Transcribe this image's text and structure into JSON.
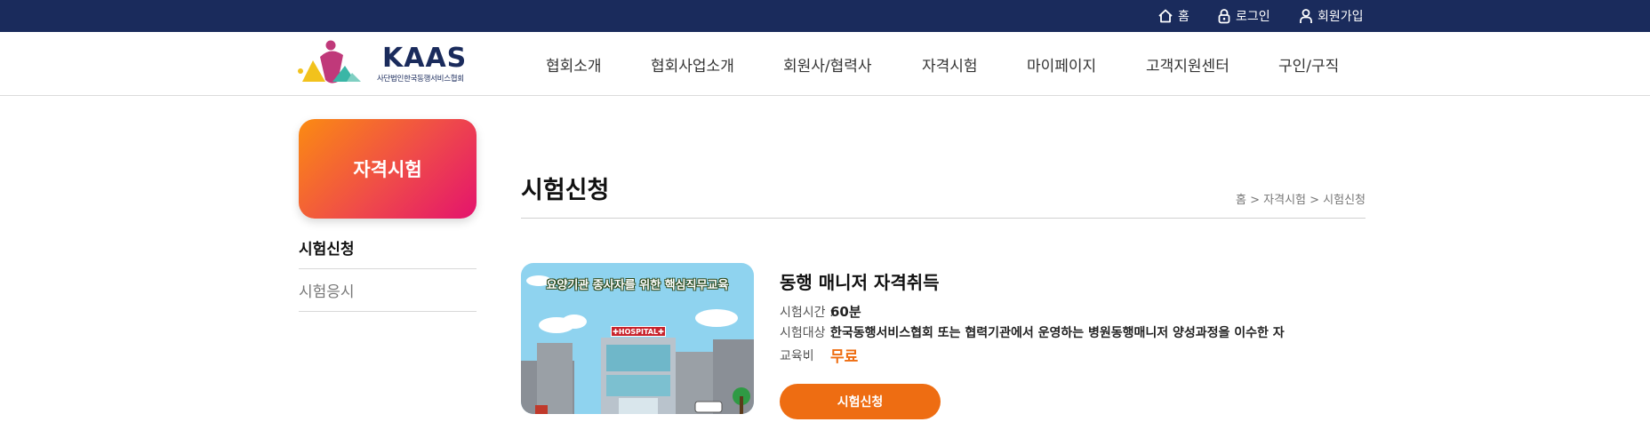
{
  "utility_nav": {
    "home": {
      "label": "홈",
      "icon": "home-icon"
    },
    "login": {
      "label": "로그인",
      "icon": "lock-icon"
    },
    "join": {
      "label": "회원가입",
      "icon": "user-icon"
    }
  },
  "logo": {
    "brand": "KAAS",
    "subtitle": "사단법인한국동행서비스협회"
  },
  "gnb": {
    "items": [
      "협회소개",
      "협회사업소개",
      "회원사/협력사",
      "자격시험",
      "마이페이지",
      "고객지원센터",
      "구인/구직"
    ]
  },
  "sidebar": {
    "title": "자격시험",
    "items": [
      {
        "label": "시험신청",
        "active": true
      },
      {
        "label": "시험응시",
        "active": false
      }
    ]
  },
  "page": {
    "title": "시험신청",
    "breadcrumb": "홈 > 자격시험 > 시험신청"
  },
  "course": {
    "image_banner": "요양기관 종사자를 위한 핵심직무교육",
    "image_sign": "✚HOSPITAL✚",
    "title": "동행 매니저 자격취득",
    "time_label": "시험시간 :",
    "time_value": "60분",
    "target_label": "시험대상 :",
    "target_value": "한국동행서비스협회 또는 협력기관에서 운영하는 병원동행매니저 양성과정을 이수한 자",
    "fee_label": "교육비",
    "fee_colon": ":",
    "fee_value": "무료",
    "apply_button": "시험신청"
  },
  "colors": {
    "topbar": "#1a2b5c",
    "accent": "#ee6d12",
    "sidebar_gradient_start": "#fb8b12",
    "sidebar_gradient_end": "#e4136d"
  }
}
